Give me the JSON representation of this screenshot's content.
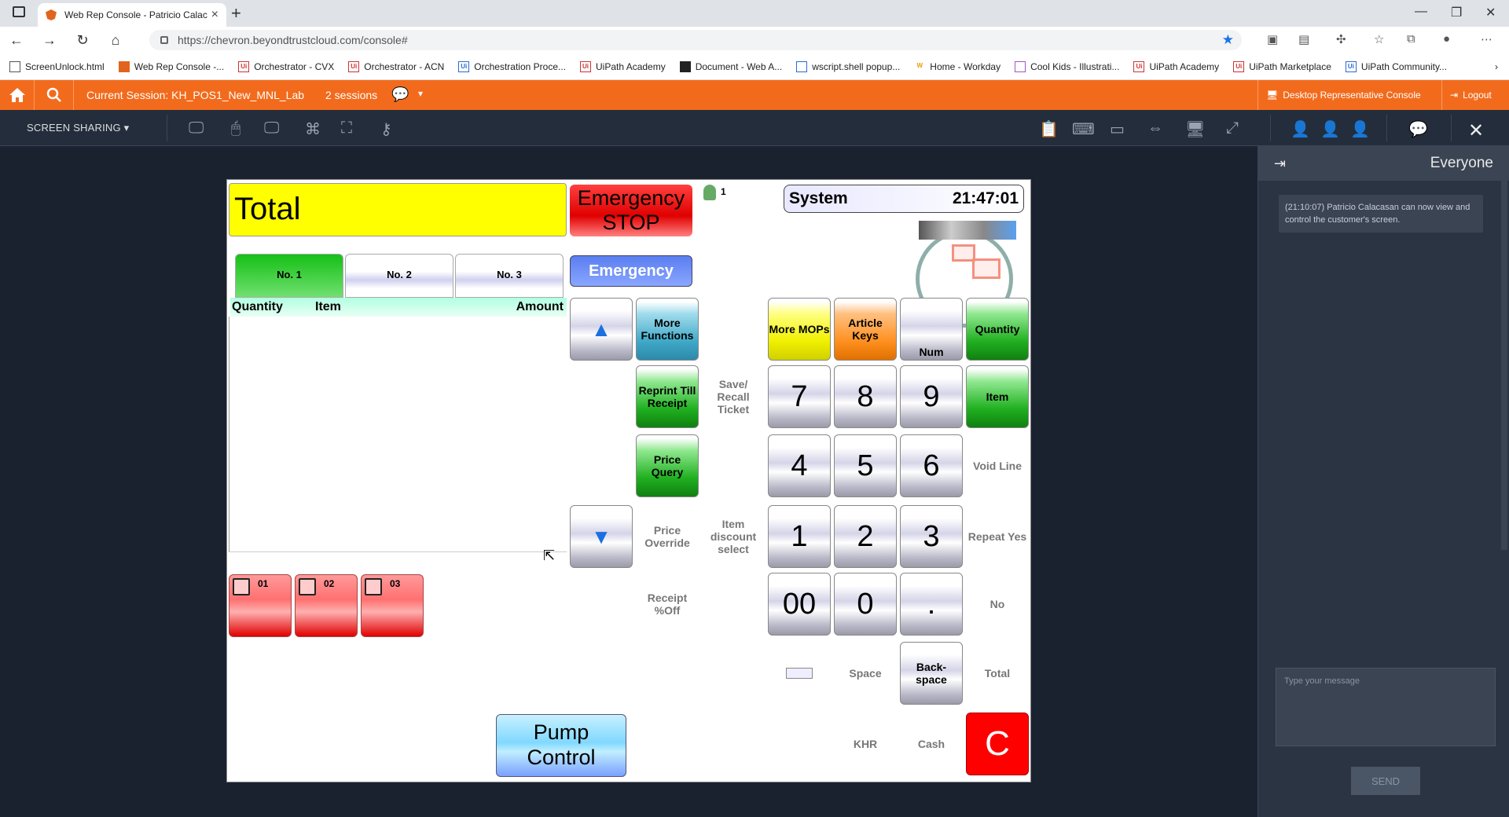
{
  "browser": {
    "tab_title": "Web Rep Console - Patricio Calac",
    "url": "https://chevron.beyondtrustcloud.com/console#",
    "bookmarks": [
      "ScreenUnlock.html",
      "Web Rep Console -...",
      "Orchestrator - CVX",
      "Orchestrator - ACN",
      "Orchestration Proce...",
      "UiPath Academy",
      "Document - Web A...",
      "wscript.shell popup...",
      "Home - Workday",
      "Cool Kids - Illustrati...",
      "UiPath Academy",
      "UiPath Marketplace",
      "UiPath Community..."
    ]
  },
  "topbar": {
    "session": "Current Session: KH_POS1_New_MNL_Lab",
    "sessions": "2 sessions",
    "drc": "Desktop Representative Console",
    "logout": "Logout"
  },
  "toolbar": {
    "screen_sharing": "SCREEN SHARING"
  },
  "chat": {
    "header": "Everyone",
    "message": "(21:10:07) Patricio Calacasan can now view and control the customer's screen.",
    "placeholder": "Type your message",
    "send": "SEND"
  },
  "pos": {
    "total": "Total",
    "emergency_stop": "Emergency STOP",
    "user_count": "1",
    "system": "System",
    "time": "21:47:01",
    "tabs": [
      "No. 1",
      "No. 2",
      "No. 3"
    ],
    "emergency": "Emergency",
    "list_headers": {
      "quantity": "Quantity",
      "item": "Item",
      "amount": "Amount"
    },
    "pumps": [
      "01",
      "02",
      "03"
    ],
    "more_functions": "More Functions",
    "reprint": "Reprint Till Receipt",
    "price_query": "Price Query",
    "price_override": "Price Override",
    "receipt_off": "Receipt %Off",
    "save_recall": "Save/ Recall Ticket",
    "item_discount": "Item discount select",
    "more_mops": "More MOPs",
    "article_keys": "Article Keys",
    "num": "Num",
    "quantity": "Quantity",
    "item": "Item",
    "void_line": "Void Line",
    "repeat_yes": "Repeat Yes",
    "no": "No",
    "total_key": "Total",
    "space": "Space",
    "backspace": "Back- space",
    "khr": "KHR",
    "cash": "Cash",
    "clear": "C",
    "digits": [
      "7",
      "8",
      "9",
      "4",
      "5",
      "6",
      "1",
      "2",
      "3",
      "00",
      "0",
      "."
    ],
    "pump_control": "Pump Control"
  }
}
